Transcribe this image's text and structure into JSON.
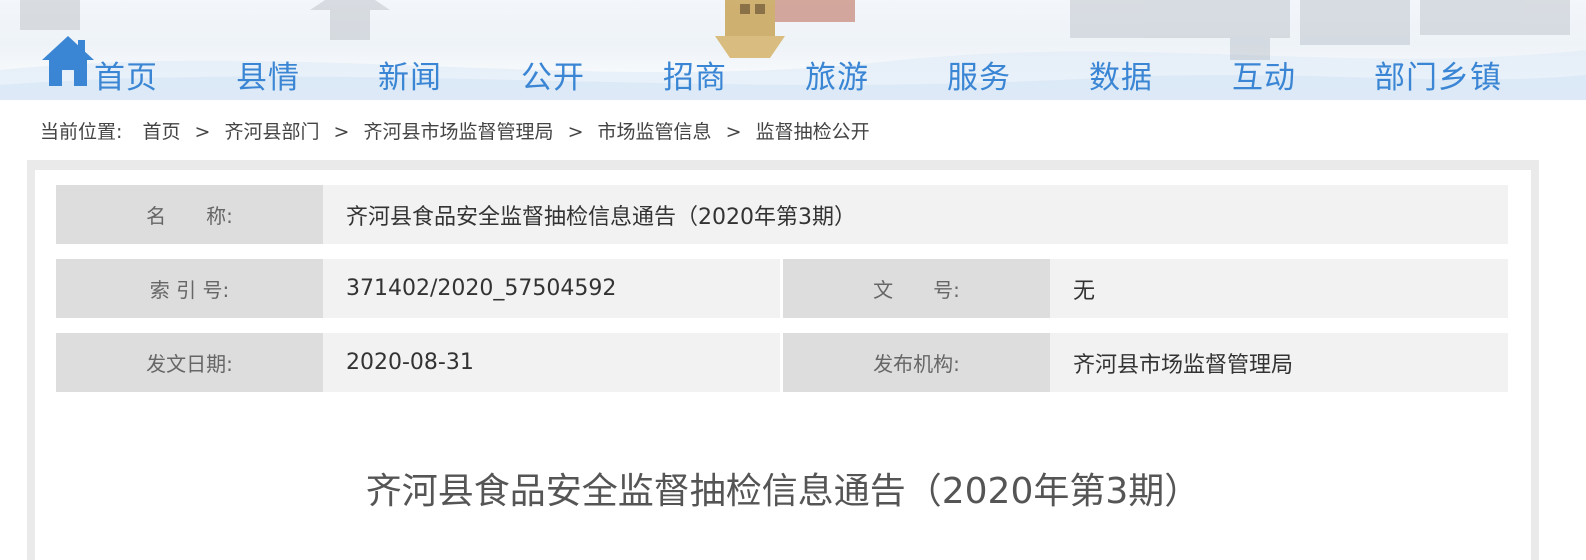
{
  "nav": {
    "home_label": "首页",
    "items": [
      "县情",
      "新闻",
      "公开",
      "招商",
      "旅游",
      "服务",
      "数据",
      "互动",
      "部门乡镇"
    ],
    "color": "#3a86d4"
  },
  "breadcrumb": {
    "lead": "当前位置:",
    "crumbs": [
      "首页",
      "齐河县部门",
      "齐河县市场监督管理局",
      "市场监管信息",
      "监督抽检公开"
    ],
    "separator": ">"
  },
  "info": {
    "name_label": "名　　称:",
    "name_value": "齐河县食品安全监督抽检信息通告（2020年第3期）",
    "index_label": "索 引 号:",
    "index_value": "371402/2020_57504592",
    "docno_label": "文　　号:",
    "docno_value": "无",
    "date_label": "发文日期:",
    "date_value": "2020-08-31",
    "org_label": "发布机构:",
    "org_value": "齐河县市场监督管理局"
  },
  "document": {
    "title": "齐河县食品安全监督抽检信息通告（2020年第3期）"
  },
  "icons": {
    "home": "home-icon"
  }
}
